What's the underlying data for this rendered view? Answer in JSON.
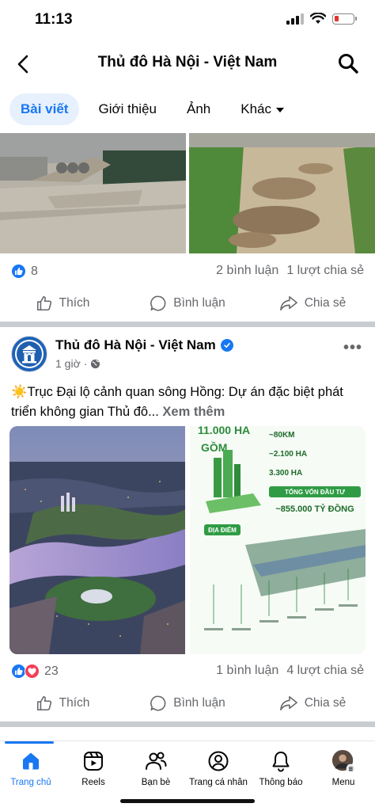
{
  "status": {
    "time": "11:13"
  },
  "header": {
    "title": "Thủ đô Hà Nội - Việt Nam",
    "back_icon": "chevron-left-icon",
    "search_icon": "search-icon"
  },
  "tabs": [
    {
      "label": "Bài viết",
      "active": true
    },
    {
      "label": "Giới thiệu",
      "active": false
    },
    {
      "label": "Ảnh",
      "active": false
    },
    {
      "label": "Khác",
      "active": false
    }
  ],
  "post1": {
    "reaction_count": "8",
    "comments": "2 bình luận",
    "shares": "1 lượt chia sẻ"
  },
  "actions": {
    "like": "Thích",
    "comment": "Bình luận",
    "share": "Chia sẻ"
  },
  "post2": {
    "author": "Thủ đô Hà Nội - Việt Nam",
    "time": "1 giờ",
    "text_emoji": "☀️",
    "text": "Trục Đại lộ cảnh quan sông Hồng: Dự án đặc biệt phát triển không gian Thủ đô...",
    "see_more": "Xem thêm",
    "infographic": {
      "headline": "11.000 HA",
      "gom": "GỒM",
      "line1": "~80KM",
      "line2": "~2.100 HA",
      "line3": "3.300 HA",
      "investment_label": "TỔNG VỐN ĐẦU TƯ",
      "investment_value": "~855.000 TỶ ĐỒNG",
      "location_label": "ĐỊA ĐIỂM"
    },
    "reaction_count": "23",
    "comments": "1 bình luận",
    "shares": "4 lượt chia sẻ"
  },
  "nav": [
    {
      "label": "Trang chủ",
      "icon": "home-icon",
      "active": true
    },
    {
      "label": "Reels",
      "icon": "reels-icon",
      "active": false
    },
    {
      "label": "Bạn bè",
      "icon": "friends-icon",
      "active": false
    },
    {
      "label": "Trang cá nhân",
      "icon": "profile-icon",
      "active": false
    },
    {
      "label": "Thông báo",
      "icon": "bell-icon",
      "active": false
    },
    {
      "label": "Menu",
      "icon": "menu-avatar-icon",
      "active": false
    }
  ],
  "colors": {
    "accent": "#1877f2",
    "muted": "#65676b",
    "love": "#f33e58"
  }
}
